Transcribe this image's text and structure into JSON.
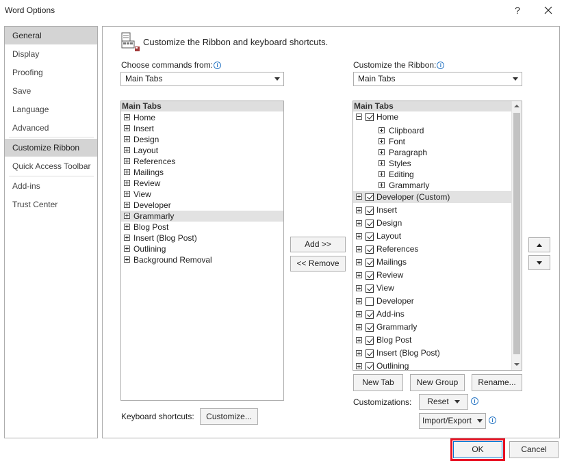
{
  "window": {
    "title": "Word Options",
    "help_label": "?"
  },
  "sidebar": {
    "items": [
      {
        "label": "General",
        "active": true
      },
      {
        "label": "Display"
      },
      {
        "label": "Proofing"
      },
      {
        "label": "Save"
      },
      {
        "label": "Language"
      },
      {
        "label": "Advanced"
      },
      {
        "label": "Customize Ribbon"
      },
      {
        "label": "Quick Access Toolbar"
      },
      {
        "label": "Add-ins"
      },
      {
        "label": "Trust Center"
      }
    ]
  },
  "header": {
    "text": "Customize the Ribbon and keyboard shortcuts."
  },
  "left": {
    "label": "Choose commands from:",
    "dropdown_value": "Main Tabs",
    "list_header": "Main Tabs",
    "items": [
      "Home",
      "Insert",
      "Design",
      "Layout",
      "References",
      "Mailings",
      "Review",
      "View",
      "Developer",
      "Grammarly",
      "Blog Post",
      "Insert (Blog Post)",
      "Outlining",
      "Background Removal"
    ],
    "selected_item": "Grammarly"
  },
  "middle": {
    "add_label": "Add >>",
    "remove_label": "<< Remove"
  },
  "right": {
    "label": "Customize the Ribbon:",
    "dropdown_value": "Main Tabs",
    "list_header": "Main Tabs",
    "home": {
      "label": "Home",
      "checked": true,
      "groups": [
        "Clipboard",
        "Font",
        "Paragraph",
        "Styles",
        "Editing",
        "Grammarly"
      ]
    },
    "tabs": [
      {
        "label": "Developer (Custom)",
        "checked": true,
        "selected": true
      },
      {
        "label": "Insert",
        "checked": true
      },
      {
        "label": "Design",
        "checked": true
      },
      {
        "label": "Layout",
        "checked": true
      },
      {
        "label": "References",
        "checked": true
      },
      {
        "label": "Mailings",
        "checked": true
      },
      {
        "label": "Review",
        "checked": true
      },
      {
        "label": "View",
        "checked": true
      },
      {
        "label": "Developer",
        "checked": false
      },
      {
        "label": "Add-ins",
        "checked": true
      },
      {
        "label": "Grammarly",
        "checked": true
      },
      {
        "label": "Blog Post",
        "checked": true
      },
      {
        "label": "Insert (Blog Post)",
        "checked": true
      },
      {
        "label": "Outlining",
        "checked": true
      }
    ],
    "new_tab_label": "New Tab",
    "new_group_label": "New Group",
    "rename_label": "Rename...",
    "customizations_label": "Customizations:",
    "reset_label": "Reset",
    "import_export_label": "Import/Export"
  },
  "keyboard": {
    "label": "Keyboard shortcuts:",
    "customize_label": "Customize..."
  },
  "footer": {
    "ok_label": "OK",
    "cancel_label": "Cancel",
    "highlight_color": "#e81123"
  }
}
